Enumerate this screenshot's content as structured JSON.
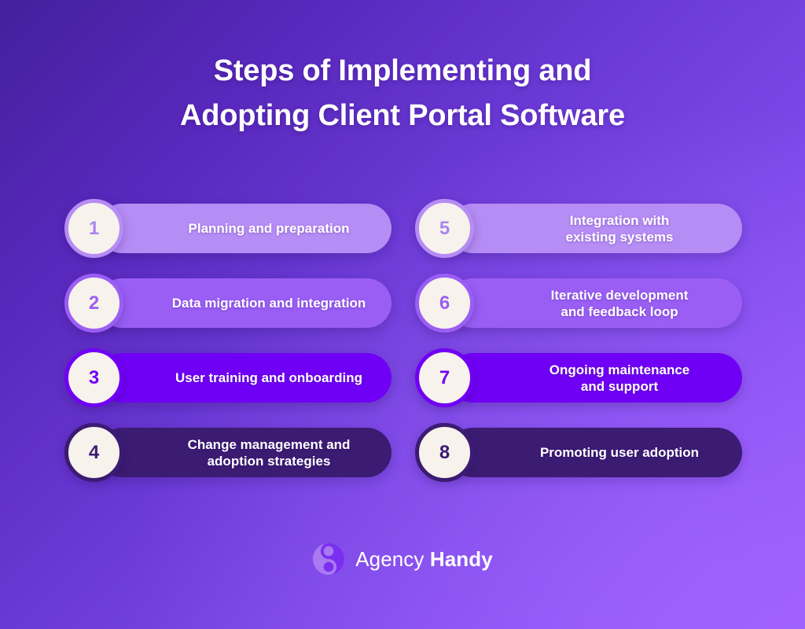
{
  "title": {
    "line1": "Steps of Implementing and",
    "line2": "Adopting Client Portal Software"
  },
  "steps": [
    {
      "number": "1",
      "label": "Planning and preparation",
      "pill_color": "#b68cf5",
      "number_color": "#ab85f0",
      "ring_color": "#b68cf5"
    },
    {
      "number": "2",
      "label": "Data migration and integration",
      "pill_color": "#9a5ef5",
      "number_color": "#9a5ef5",
      "ring_color": "#9a5ef5"
    },
    {
      "number": "3",
      "label": "User training and onboarding",
      "pill_color": "#7000f5",
      "number_color": "#7000f5",
      "ring_color": "#7000f5"
    },
    {
      "number": "4",
      "label": "Change management and\nadoption strategies",
      "pill_color": "#3c1b73",
      "number_color": "#3c1b73",
      "ring_color": "#3c1b73"
    },
    {
      "number": "5",
      "label": "Integration with\nexisting systems",
      "pill_color": "#b68cf5",
      "number_color": "#ab85f0",
      "ring_color": "#b68cf5"
    },
    {
      "number": "6",
      "label": "Iterative development\nand feedback loop",
      "pill_color": "#9a5ef5",
      "number_color": "#9a5ef5",
      "ring_color": "#9a5ef5"
    },
    {
      "number": "7",
      "label": "Ongoing maintenance\nand support",
      "pill_color": "#7000f5",
      "number_color": "#7000f5",
      "ring_color": "#7000f5"
    },
    {
      "number": "8",
      "label": "Promoting user adoption",
      "pill_color": "#3c1b73",
      "number_color": "#3c1b73",
      "ring_color": "#3c1b73"
    }
  ],
  "logo": {
    "name_light": "Agency",
    "name_bold": "Handy",
    "mark_color_light": "#a97af0",
    "mark_color_dark": "#7b2ff0"
  },
  "theme": {
    "background_from": "#43209c",
    "background_to": "#9a5cff",
    "badge_fill": "#f7f2ec",
    "text_on_pill": "#ffffff"
  }
}
